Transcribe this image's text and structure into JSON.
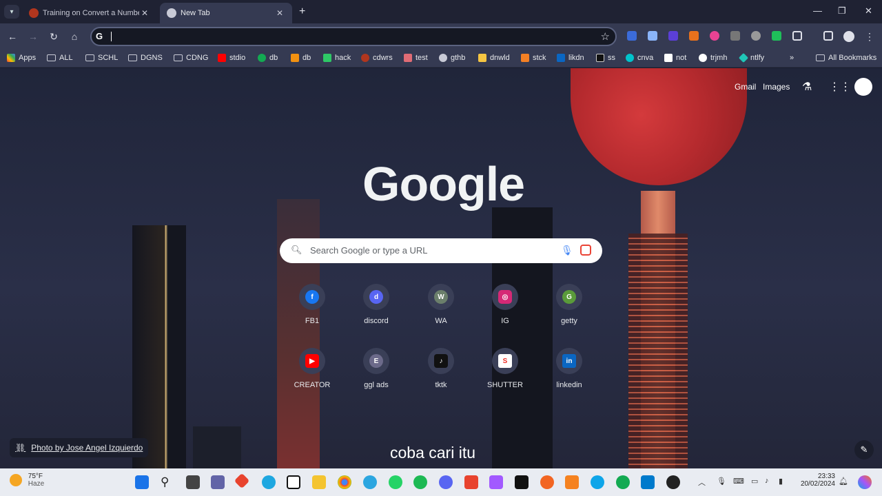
{
  "tabs": [
    {
      "title": "Training on Convert a Number T",
      "active": false
    },
    {
      "title": "New Tab",
      "active": true
    }
  ],
  "bookmarks": [
    {
      "label": "Apps",
      "icon": "apps-grid-icon"
    },
    {
      "label": "ALL",
      "icon": "folder-icon"
    },
    {
      "label": "SCHL",
      "icon": "folder-icon"
    },
    {
      "label": "DGNS",
      "icon": "folder-icon"
    },
    {
      "label": "CDNG",
      "icon": "folder-icon"
    },
    {
      "label": "stdio",
      "icon": "youtube-icon"
    },
    {
      "label": "db",
      "icon": "mongodb-icon"
    },
    {
      "label": "db",
      "icon": "db-icon"
    },
    {
      "label": "hack",
      "icon": "hack-icon"
    },
    {
      "label": "cdwrs",
      "icon": "codewars-icon"
    },
    {
      "label": "test",
      "icon": "test-icon"
    },
    {
      "label": "gthb",
      "icon": "github-icon"
    },
    {
      "label": "dnwld",
      "icon": "download-icon"
    },
    {
      "label": "stck",
      "icon": "stackoverflow-icon"
    },
    {
      "label": "likdn",
      "icon": "linkedin-icon"
    },
    {
      "label": "ss",
      "icon": "ss-icon"
    },
    {
      "label": "cnva",
      "icon": "canva-icon"
    },
    {
      "label": "not",
      "icon": "notion-icon"
    },
    {
      "label": "trjmh",
      "icon": "translate-icon"
    },
    {
      "label": "ntlfy",
      "icon": "netlify-icon"
    }
  ],
  "all_bookmarks_label": "All Bookmarks",
  "header_links": {
    "gmail": "Gmail",
    "images": "Images"
  },
  "logo_text": "Google",
  "search": {
    "placeholder": "Search Google or type a URL"
  },
  "shortcuts": [
    {
      "label": "FB1",
      "icon": "facebook-icon",
      "color": "#1877f2",
      "glyph": "f"
    },
    {
      "label": "discord",
      "icon": "discord-icon",
      "color": "#5865f2",
      "glyph": "d"
    },
    {
      "label": "WA",
      "icon": "whatsapp-icon",
      "color": "#6b7f6b",
      "glyph": "W"
    },
    {
      "label": "IG",
      "icon": "instagram-icon",
      "color": "#d62976",
      "glyph": "ig"
    },
    {
      "label": "getty",
      "icon": "getty-icon",
      "color": "#5a9b3a",
      "glyph": "G"
    },
    {
      "label": "CREATOR",
      "icon": "youtube-icon",
      "color": "#ff0000",
      "glyph": "▶"
    },
    {
      "label": "ggl ads",
      "icon": "google-ads-icon",
      "color": "#6c6a8a",
      "glyph": "E"
    },
    {
      "label": "tktk",
      "icon": "tiktok-icon",
      "color": "#111111",
      "glyph": "♪"
    },
    {
      "label": "SHUTTER",
      "icon": "shutterstock-icon",
      "color": "#ee2b24",
      "glyph": "S"
    },
    {
      "label": "linkedin",
      "icon": "linkedin-icon",
      "color": "#0a66c2",
      "glyph": "in"
    }
  ],
  "photo_credit": "Photo by Jose Angel Izquierdo",
  "caption": "coba cari itu",
  "taskbar": {
    "weather_temp": "75°F",
    "weather_desc": "Haze",
    "time": "23:33",
    "date": "20/02/2024"
  }
}
